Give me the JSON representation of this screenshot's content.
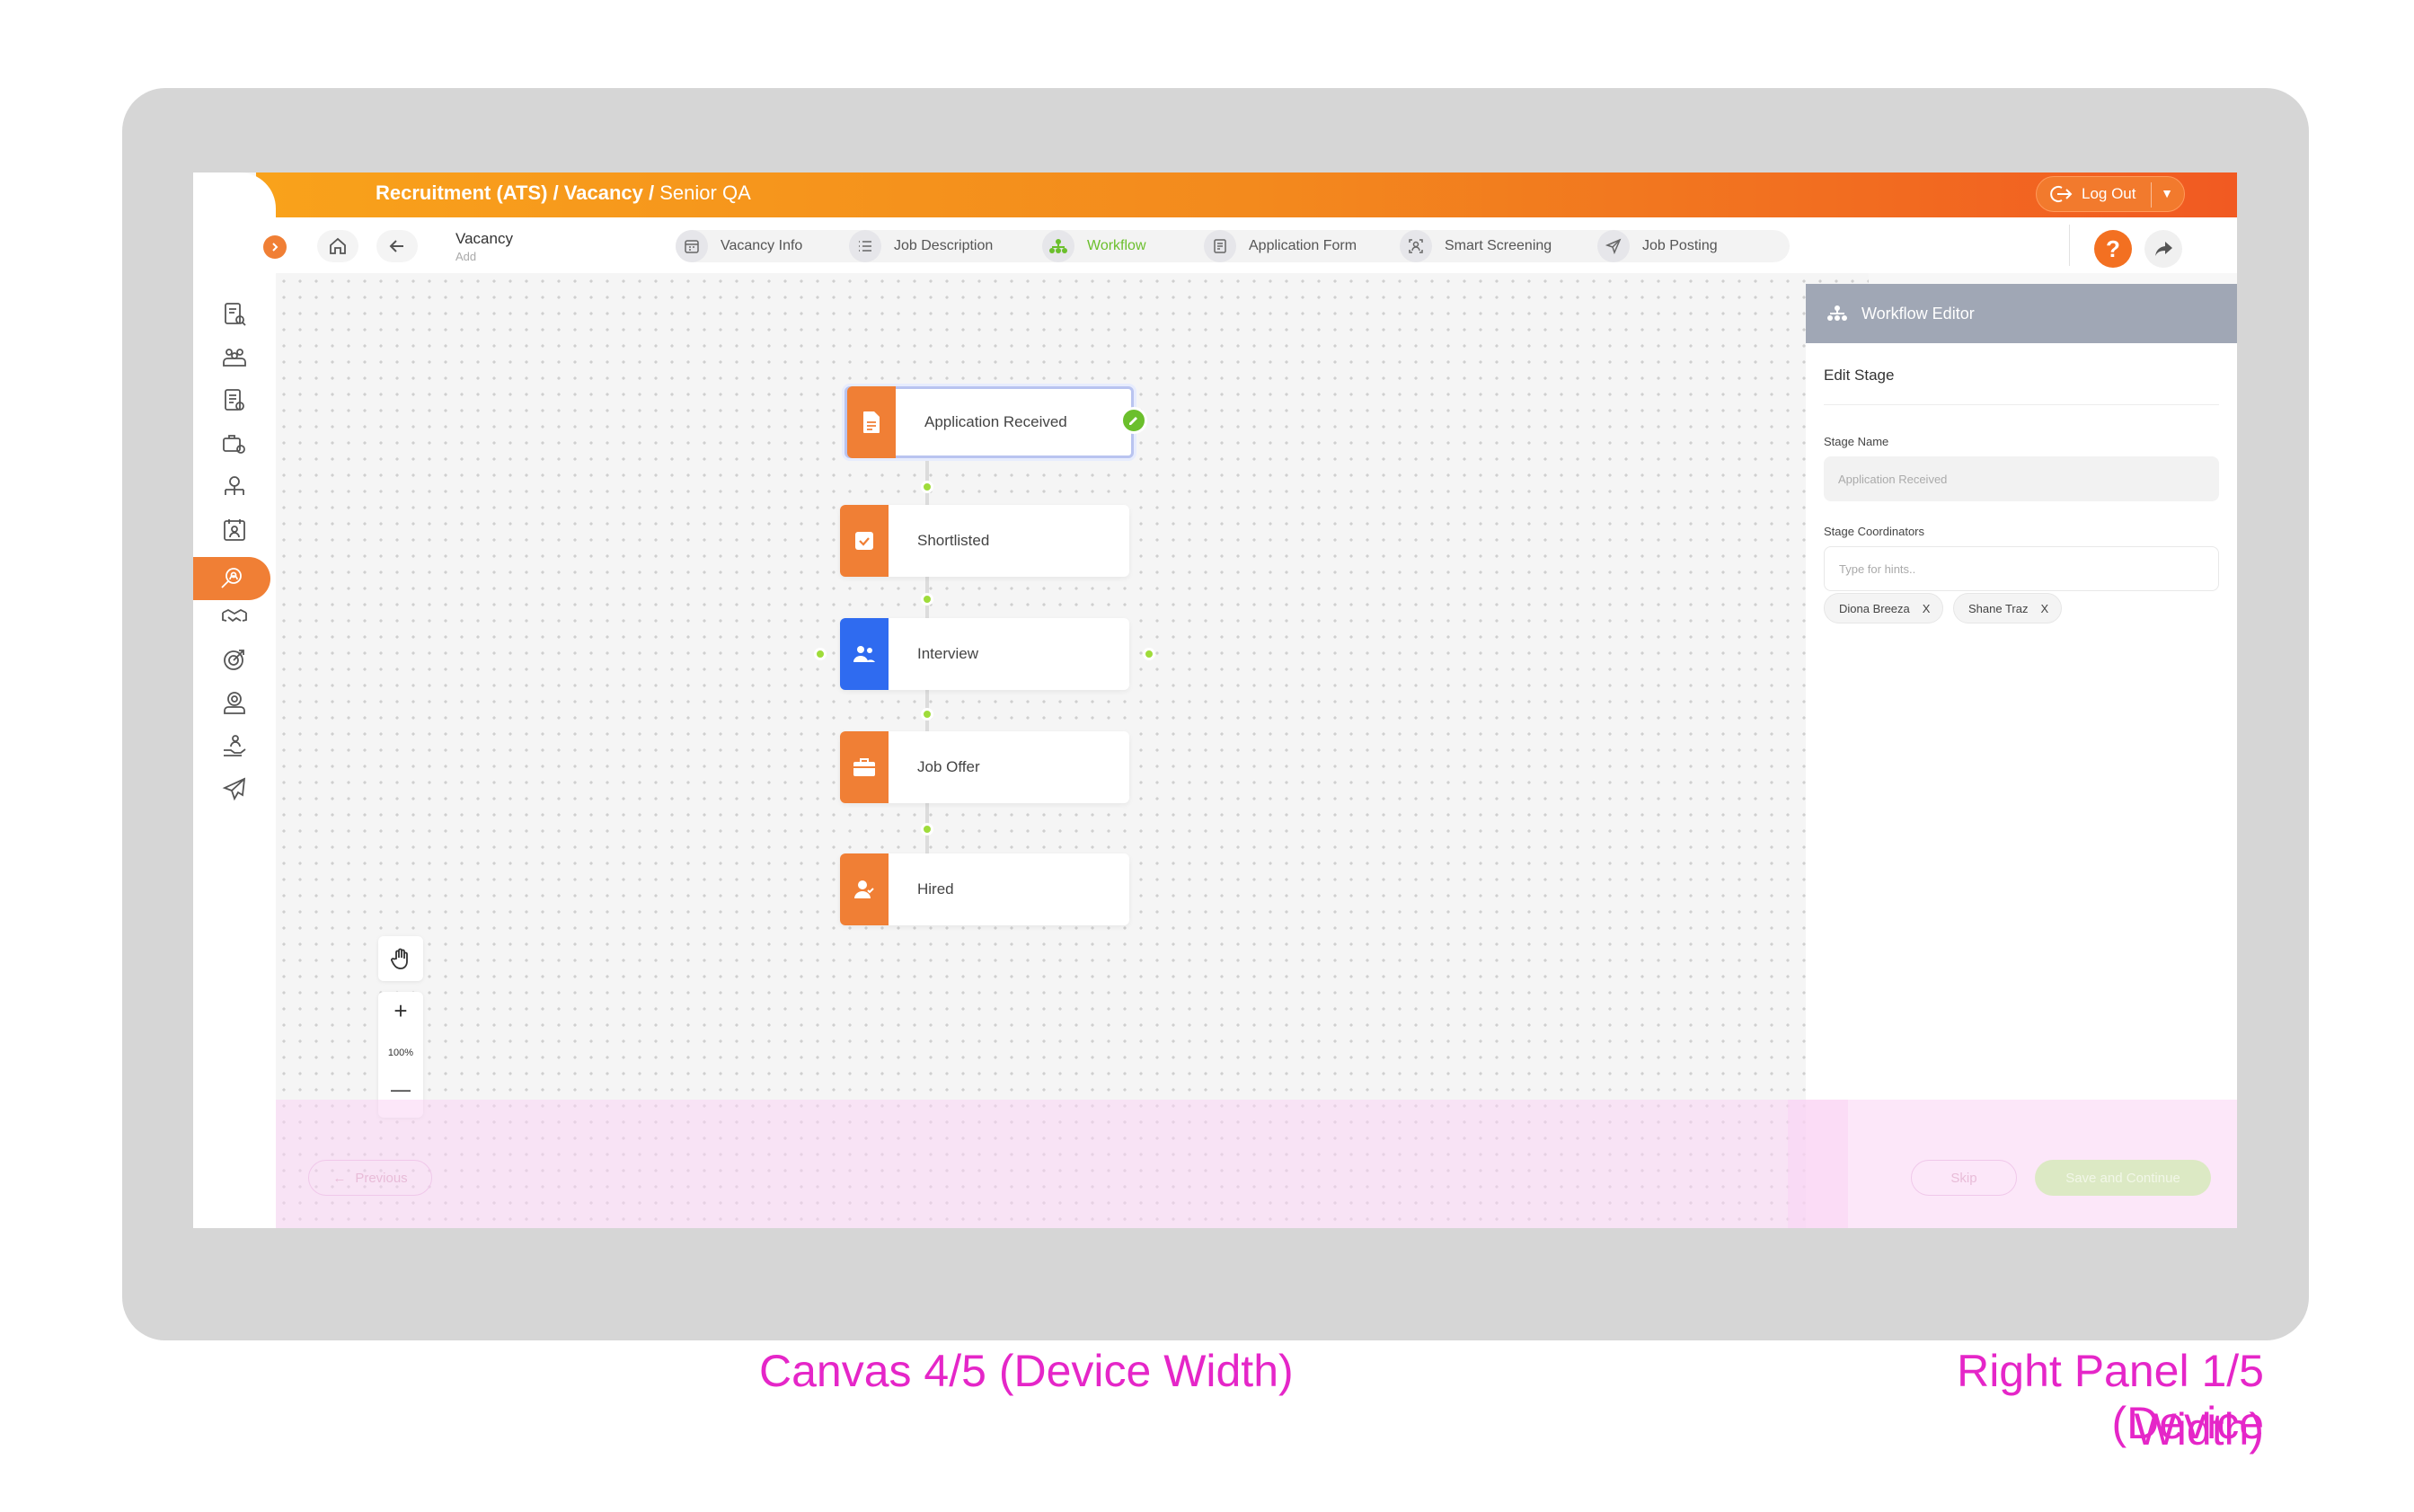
{
  "topbar": {
    "crumb_bold": "Recruitment (ATS) / Vacancy /",
    "crumb_rest": " Senior QA",
    "logout_label": "Log Out"
  },
  "header": {
    "vacancy_title": "Vacancy",
    "vacancy_sub": "Add"
  },
  "steps": [
    {
      "label": "Vacancy Info"
    },
    {
      "label": "Job Description"
    },
    {
      "label": "Workflow"
    },
    {
      "label": "Application Form"
    },
    {
      "label": "Smart Screening"
    },
    {
      "label": "Job Posting"
    }
  ],
  "help_label": "?",
  "workflow": {
    "nodes": [
      {
        "label": "Application Received"
      },
      {
        "label": "Shortlisted"
      },
      {
        "label": "Interview"
      },
      {
        "label": "Job Offer"
      },
      {
        "label": "Hired"
      }
    ]
  },
  "zoom": {
    "plus": "+",
    "level": "100%",
    "minus": "—"
  },
  "panel": {
    "title": "Workflow Editor",
    "section": "Edit Stage",
    "stage_name_label": "Stage Name",
    "stage_name_placeholder": "Application Received",
    "coordinators_label": "Stage Coordinators",
    "coordinators_placeholder": "Type for hints..",
    "chips": [
      {
        "name": "Diona Breeza",
        "remove": "X"
      },
      {
        "name": "Shane Traz",
        "remove": "X"
      }
    ]
  },
  "footer": {
    "previous": "Previous",
    "skip": "Skip",
    "save": "Save and Continue"
  },
  "captions": {
    "canvas": "Canvas 4/5 (Device Width)",
    "panel_line1": "Right Panel 1/5 (Device",
    "panel_line2": "Width)"
  },
  "colors": {
    "accent_orange": "#f07f35",
    "accent_green": "#6bbf2c",
    "interview_blue": "#2f6bf0",
    "caption_magenta": "#e526c8"
  }
}
